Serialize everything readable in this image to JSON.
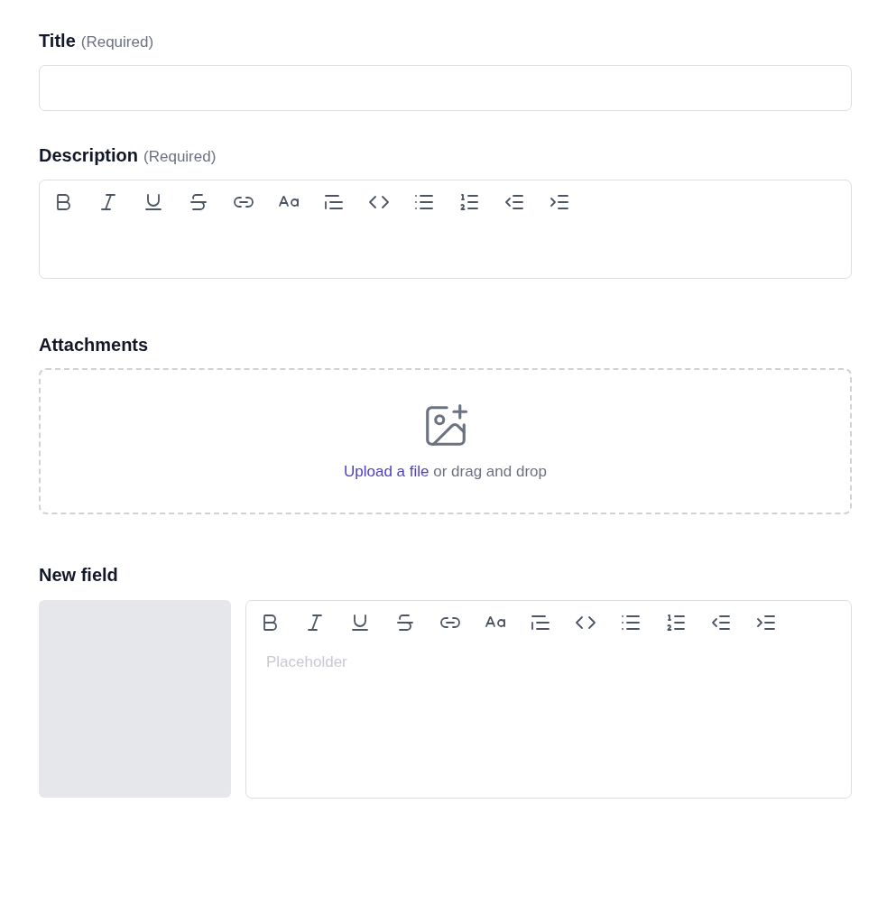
{
  "fields": [
    {
      "kind": "text",
      "label": "Title",
      "hint": "(Required)"
    },
    {
      "kind": "rich",
      "label": "Description",
      "hint": "(Required)"
    },
    {
      "kind": "upload",
      "label": "Attachments",
      "link": "Upload a file",
      "text": "or drag and drop"
    },
    {
      "kind": "media-rich",
      "label": "New field",
      "placeholder": "Placeholder"
    }
  ]
}
